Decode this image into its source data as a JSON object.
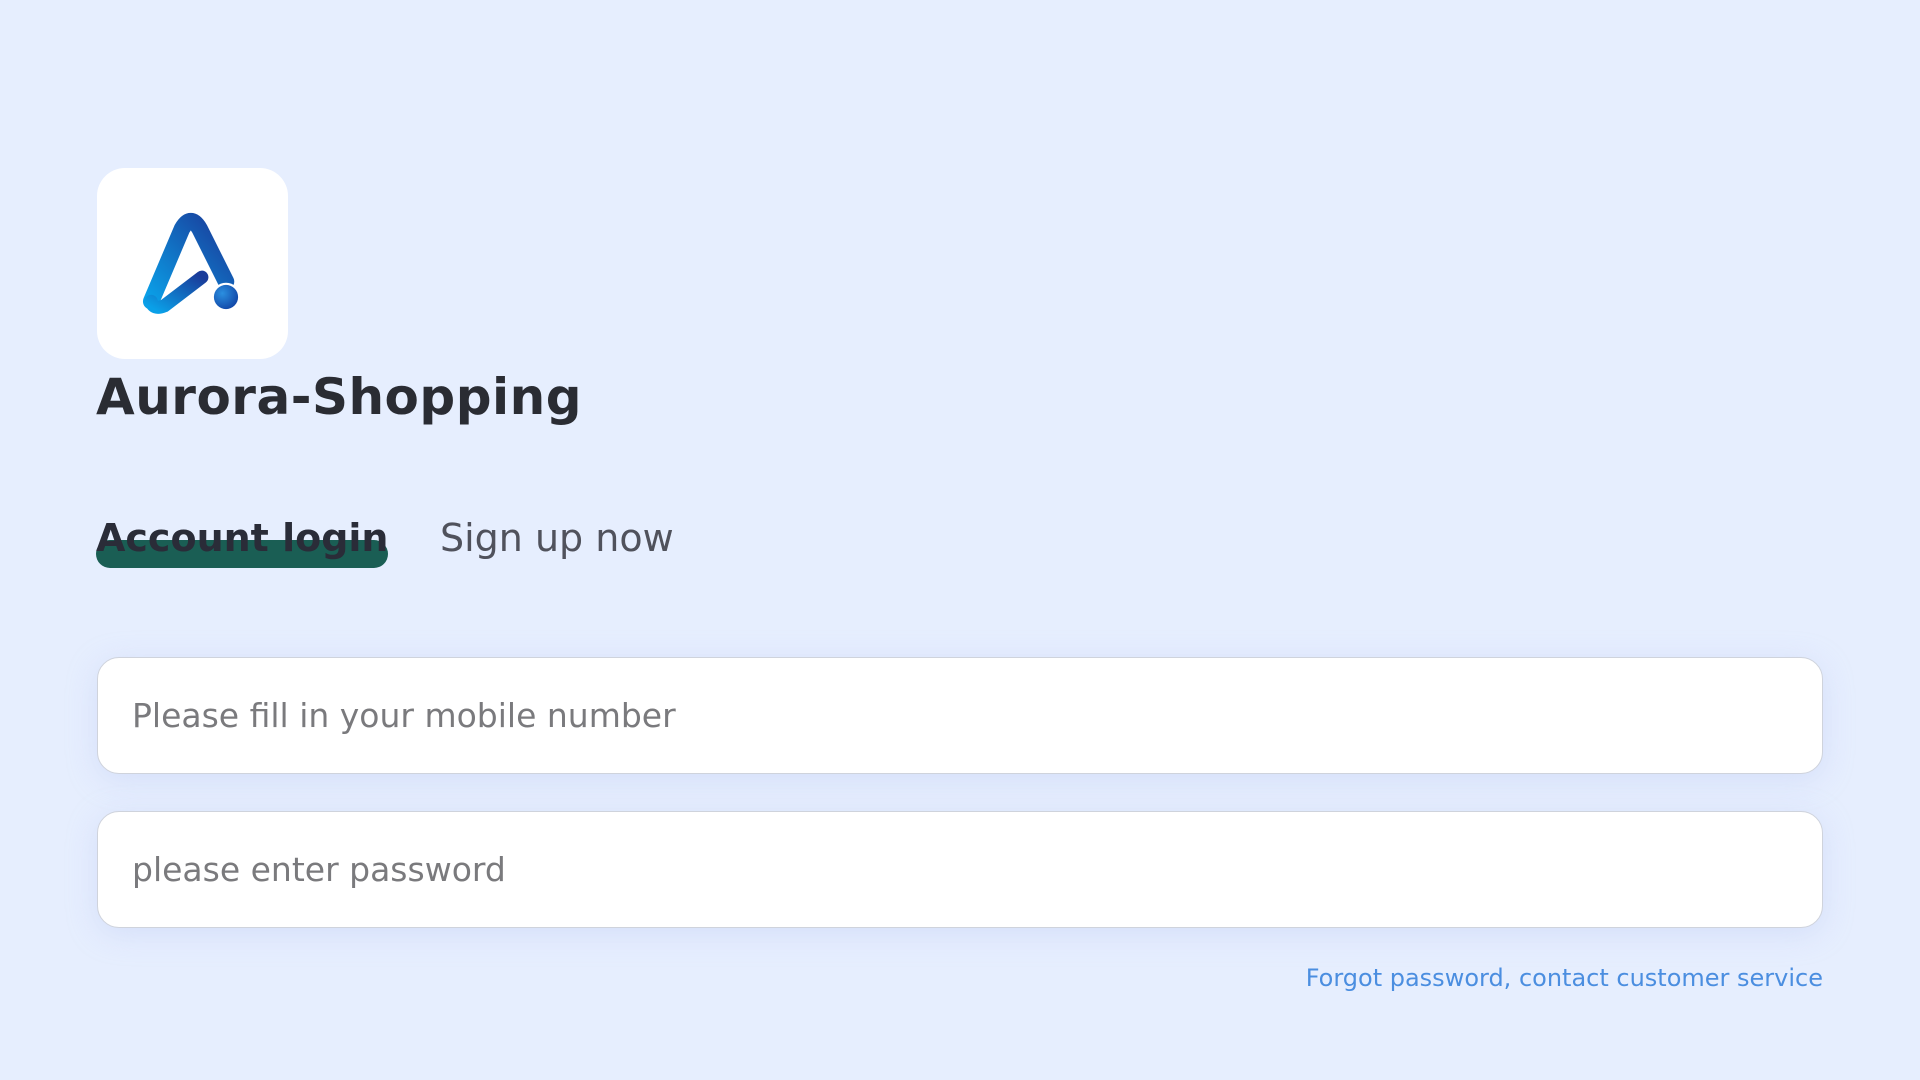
{
  "app": {
    "title": "Aurora-Shopping",
    "logo_icon": "aurora-logo-icon",
    "logo_colors": [
      "#1a3c9a",
      "#0aa0e8"
    ]
  },
  "tabs": [
    {
      "label": "Account login",
      "active": true
    },
    {
      "label": "Sign up now",
      "active": false
    }
  ],
  "accent_color": "#1a5e54",
  "form": {
    "phone": {
      "placeholder": "Please fill in your mobile number",
      "value": ""
    },
    "password": {
      "placeholder": "please enter password",
      "value": ""
    }
  },
  "forgot_link": "Forgot password, contact customer service"
}
